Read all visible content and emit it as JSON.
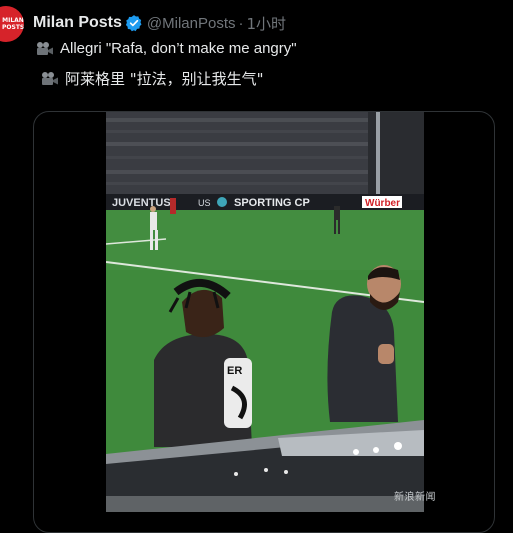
{
  "tweet": {
    "author_name": "Milan Posts",
    "handle": "@MilanPosts",
    "separator": "·",
    "time": "1小时",
    "avatar_text": "MILAN POSTS",
    "text_line1": "Allegri \"Rafa, don’t make me angry\"",
    "text_line2": "阿莱格里 \"拉法，别让我生气\""
  },
  "icons": {
    "verified": "verified-badge-icon",
    "line1": "movie-camera-icon",
    "line2": "movie-camera-icon"
  },
  "video": {
    "banner_texts": [
      "JUVENTUS",
      "US",
      "SPORTING CP",
      "Würber"
    ],
    "shirt_text": "ER"
  },
  "watermark": "新浪新闻",
  "colors": {
    "avatar": "#d6232a",
    "verified": "#1d9bf0",
    "pitch": "#3f8a3c",
    "background": "#000000"
  }
}
